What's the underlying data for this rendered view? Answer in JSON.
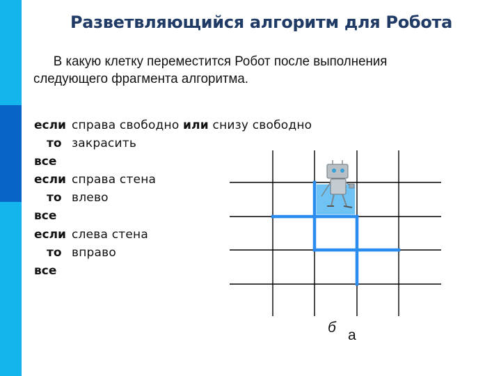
{
  "title": "Разветвляющийся алгоритм для Робота",
  "question": "В какую клетку переместится Робот после выполнения следующего фрагмента алгоритма.",
  "colors": {
    "side_bar": "#13b5ec",
    "side_bar_accent": "#0a63c6",
    "title": "#1f3b66",
    "wall": "#2a8cef",
    "robot_cell": "#6ec2f4",
    "grid_line": "#000000"
  },
  "algorithm": [
    {
      "type": "if",
      "keyword": "если",
      "parts": [
        {
          "text": "справа свободно ",
          "bold": false
        },
        {
          "text": "или",
          "bold": true
        },
        {
          "text": " снизу свободно",
          "bold": false
        }
      ]
    },
    {
      "type": "then",
      "keyword": "то",
      "parts": [
        {
          "text": "закрасить",
          "bold": false
        }
      ]
    },
    {
      "type": "end",
      "keyword": "все",
      "parts": []
    },
    {
      "type": "if",
      "keyword": "если",
      "parts": [
        {
          "text": "справа стена",
          "bold": false
        }
      ]
    },
    {
      "type": "then",
      "keyword": "то",
      "parts": [
        {
          "text": "влево",
          "bold": false
        }
      ]
    },
    {
      "type": "end",
      "keyword": "все",
      "parts": []
    },
    {
      "type": "if",
      "keyword": "если",
      "parts": [
        {
          "text": "слева стена",
          "bold": false
        }
      ]
    },
    {
      "type": "then",
      "keyword": "то",
      "parts": [
        {
          "text": "вправо",
          "bold": false
        }
      ]
    },
    {
      "type": "end",
      "keyword": "все",
      "parts": []
    }
  ],
  "field": {
    "columns": 5,
    "rows": 4,
    "robot_cell": {
      "col": 2,
      "row": 1
    },
    "walls": [
      {
        "orientation": "vertical",
        "line": 2,
        "from": 0,
        "to": 2
      },
      {
        "orientation": "horizontal",
        "line": 1,
        "from": 1,
        "to": 3
      },
      {
        "orientation": "vertical",
        "line": 3,
        "from": 1,
        "to": 3
      },
      {
        "orientation": "horizontal",
        "line": 2,
        "from": 2,
        "to": 4
      }
    ],
    "cell_labels": [
      {
        "text": "б",
        "col": 2,
        "row": 3
      },
      {
        "text": "а",
        "col": 3,
        "row": 3
      }
    ]
  }
}
